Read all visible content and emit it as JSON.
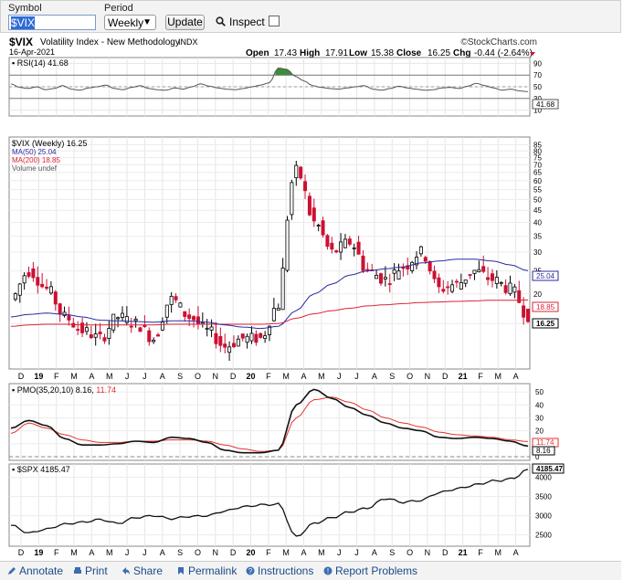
{
  "toolbar": {
    "symbol_label": "Symbol",
    "symbol_value": "$VIX",
    "period_label": "Period",
    "period_value": "Weekly",
    "update_label": "Update",
    "inspect_label": "Inspect"
  },
  "header": {
    "symbol": "$VIX",
    "name": "Volatility Index - New Methodology",
    "exchange": "INDX",
    "date": "16-Apr-2021",
    "brand": "©StockCharts.com",
    "open_label": "Open",
    "open": "17.43",
    "high_label": "High",
    "high": "17.91",
    "low_label": "Low",
    "low": "15.38",
    "close_label": "Close",
    "close": "16.25",
    "chg_label": "Chg",
    "chg": "-0.44 (-2.64%)"
  },
  "rsi": {
    "label": "RSI(14) 41.68",
    "ticks": [
      "90",
      "70",
      "50",
      "30",
      "10"
    ],
    "value_tag": "41.68"
  },
  "price": {
    "legend": [
      "$VIX (Weekly) 16.25",
      "MA(50) 25.04",
      "MA(200) 18.85",
      "Volume undef"
    ],
    "ticks": [
      "85",
      "80",
      "75",
      "70",
      "65",
      "60",
      "55",
      "50",
      "45",
      "40",
      "35",
      "30",
      "25",
      "20",
      "15"
    ],
    "ma50_tag": "25.04",
    "ma200_tag": "18.85",
    "close_tag": "16.25"
  },
  "months": [
    "D",
    "19",
    "F",
    "M",
    "A",
    "M",
    "J",
    "J",
    "A",
    "S",
    "O",
    "N",
    "D",
    "20",
    "F",
    "M",
    "A",
    "M",
    "J",
    "J",
    "A",
    "S",
    "O",
    "N",
    "D",
    "21",
    "F",
    "M",
    "A"
  ],
  "pmo": {
    "label_prefix": "PMO(35,20,10)",
    "value1": "8.16",
    "value2": "11.74",
    "ticks": [
      "50",
      "40",
      "30",
      "20",
      "10",
      "0"
    ],
    "tag1": "11.74",
    "tag2": "8.16"
  },
  "spx": {
    "label": "$SPX 4185.47",
    "ticks": [
      "4000",
      "3500",
      "3000",
      "2500"
    ],
    "tag": "4185.47"
  },
  "footer": {
    "annotate": "Annotate",
    "print": "Print",
    "share": "Share",
    "permalink": "Permalink",
    "instructions": "Instructions",
    "report": "Report Problems"
  },
  "colors": {
    "up_candle": "#000000",
    "down_candle": "#cc1133",
    "ma50": "#2a2aa0",
    "ma200": "#dd2233",
    "pmo_signal": "#e53030",
    "rsi_fill": "#3c8c3c"
  },
  "chart_data": [
    {
      "type": "line",
      "title": "RSI(14) 41.68",
      "ylim": [
        0,
        100
      ],
      "reference_lines": [
        70,
        30
      ],
      "series": [
        {
          "name": "RSI(14)",
          "values": [
            55,
            49,
            47,
            50,
            45,
            47,
            52,
            46,
            44,
            48,
            50,
            53,
            47,
            45,
            49,
            52,
            47,
            45,
            44,
            48,
            46,
            50,
            55,
            51,
            48,
            46,
            45,
            47,
            50,
            53,
            57,
            82,
            80,
            68,
            60,
            52,
            49,
            47,
            46,
            48,
            50,
            52,
            46,
            44,
            47,
            51,
            48,
            46,
            44,
            45,
            48,
            49,
            47,
            51,
            56,
            52,
            48,
            44,
            46,
            43,
            41.68
          ]
        }
      ]
    },
    {
      "type": "line",
      "title": "$VIX (Weekly) 16.25",
      "ylim": [
        10,
        85
      ],
      "y_scale": "log",
      "x": [
        "2018-11",
        "2018-12",
        "2019-01",
        "2019-02",
        "2019-03",
        "2019-04",
        "2019-05",
        "2019-06",
        "2019-07",
        "2019-08",
        "2019-09",
        "2019-10",
        "2019-11",
        "2019-12",
        "2020-01",
        "2020-02",
        "2020-03",
        "2020-04",
        "2020-05",
        "2020-06",
        "2020-07",
        "2020-08",
        "2020-09",
        "2020-10",
        "2020-11",
        "2020-12",
        "2021-01",
        "2021-02",
        "2021-03",
        "2021-04"
      ],
      "series": [
        {
          "name": "$VIX (Weekly)",
          "values": [
            19,
            25,
            21,
            16,
            14,
            13,
            16,
            15,
            13,
            19,
            16,
            14,
            12,
            13,
            13,
            18,
            66,
            40,
            30,
            33,
            25,
            23,
            26,
            30,
            21,
            22,
            25,
            23,
            21,
            16.25
          ]
        },
        {
          "name": "MA(50)",
          "values": [
            16,
            16.4,
            16.6,
            16.4,
            16,
            15.5,
            15.4,
            15.3,
            15.2,
            15.4,
            15.4,
            15.2,
            14.8,
            14.5,
            14.3,
            14.6,
            17,
            20,
            22,
            24,
            25,
            25.5,
            26,
            27,
            27.5,
            28,
            28,
            27.5,
            26.5,
            25.04
          ]
        },
        {
          "name": "MA(200)",
          "values": [
            14.6,
            14.8,
            14.9,
            14.9,
            14.8,
            14.8,
            14.8,
            14.8,
            14.8,
            14.9,
            14.9,
            14.9,
            14.9,
            14.9,
            14.9,
            15,
            15.8,
            16.5,
            17,
            17.4,
            17.8,
            18,
            18.2,
            18.4,
            18.5,
            18.6,
            18.7,
            18.8,
            18.8,
            18.85
          ]
        }
      ]
    },
    {
      "type": "line",
      "title": "PMO(35,20,10) 8.16, 11.74",
      "ylim": [
        0,
        55
      ],
      "series": [
        {
          "name": "PMO",
          "values": [
            22,
            28,
            24,
            14,
            9,
            9,
            10,
            12,
            11,
            15,
            14,
            11,
            5,
            3,
            3,
            5,
            40,
            52,
            45,
            38,
            32,
            26,
            22,
            20,
            15,
            14,
            15,
            14,
            12,
            8.16
          ]
        },
        {
          "name": "Signal",
          "values": [
            18,
            26,
            22,
            17,
            13,
            11,
            11,
            12,
            12,
            13,
            13,
            12,
            9,
            6,
            4,
            5,
            30,
            44,
            46,
            42,
            36,
            30,
            26,
            23,
            19,
            17,
            16,
            15,
            13,
            11.74
          ]
        }
      ]
    },
    {
      "type": "line",
      "title": "$SPX 4185.47",
      "ylim": [
        2300,
        4300
      ],
      "series": [
        {
          "name": "$SPX",
          "values": [
            2750,
            2550,
            2650,
            2780,
            2830,
            2900,
            2800,
            2950,
            3000,
            2920,
            2980,
            3000,
            3120,
            3230,
            3280,
            3300,
            2450,
            2800,
            2950,
            3100,
            3200,
            3450,
            3350,
            3400,
            3600,
            3700,
            3800,
            3900,
            3950,
            4185.47
          ]
        }
      ]
    }
  ]
}
